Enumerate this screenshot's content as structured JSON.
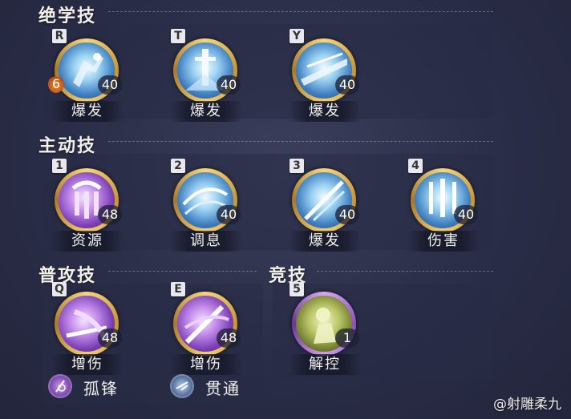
{
  "sections": {
    "ultimate": {
      "title": "绝学技",
      "skills": [
        {
          "key": "R",
          "cost": "40",
          "charges": "6",
          "label": "爆发"
        },
        {
          "key": "T",
          "cost": "40",
          "label": "爆发"
        },
        {
          "key": "Y",
          "cost": "40",
          "label": "爆发"
        }
      ]
    },
    "active": {
      "title": "主动技",
      "skills": [
        {
          "key": "1",
          "cost": "48",
          "label": "资源"
        },
        {
          "key": "2",
          "cost": "40",
          "label": "调息"
        },
        {
          "key": "3",
          "cost": "40",
          "label": "爆发"
        },
        {
          "key": "4",
          "cost": "40",
          "label": "伤害"
        }
      ]
    },
    "basic": {
      "title": "普攻技",
      "skills": [
        {
          "key": "Q",
          "cost": "48",
          "label": "增伤"
        },
        {
          "key": "E",
          "cost": "48",
          "label": "增伤"
        }
      ],
      "modifiers": [
        {
          "icon": "sword-stance-icon",
          "label": "孤锋"
        },
        {
          "icon": "pierce-icon",
          "label": "贯通"
        }
      ]
    },
    "competitive": {
      "title": "竞技",
      "skills": [
        {
          "key": "5",
          "cost": "1",
          "label": "解控"
        }
      ]
    }
  },
  "watermark": "@射雕柔九",
  "colors": {
    "background": "#2a2d47",
    "gold_ring": "#e0b44c",
    "purple_ring": "#9b5fd0",
    "text": "#f2f0ea"
  }
}
